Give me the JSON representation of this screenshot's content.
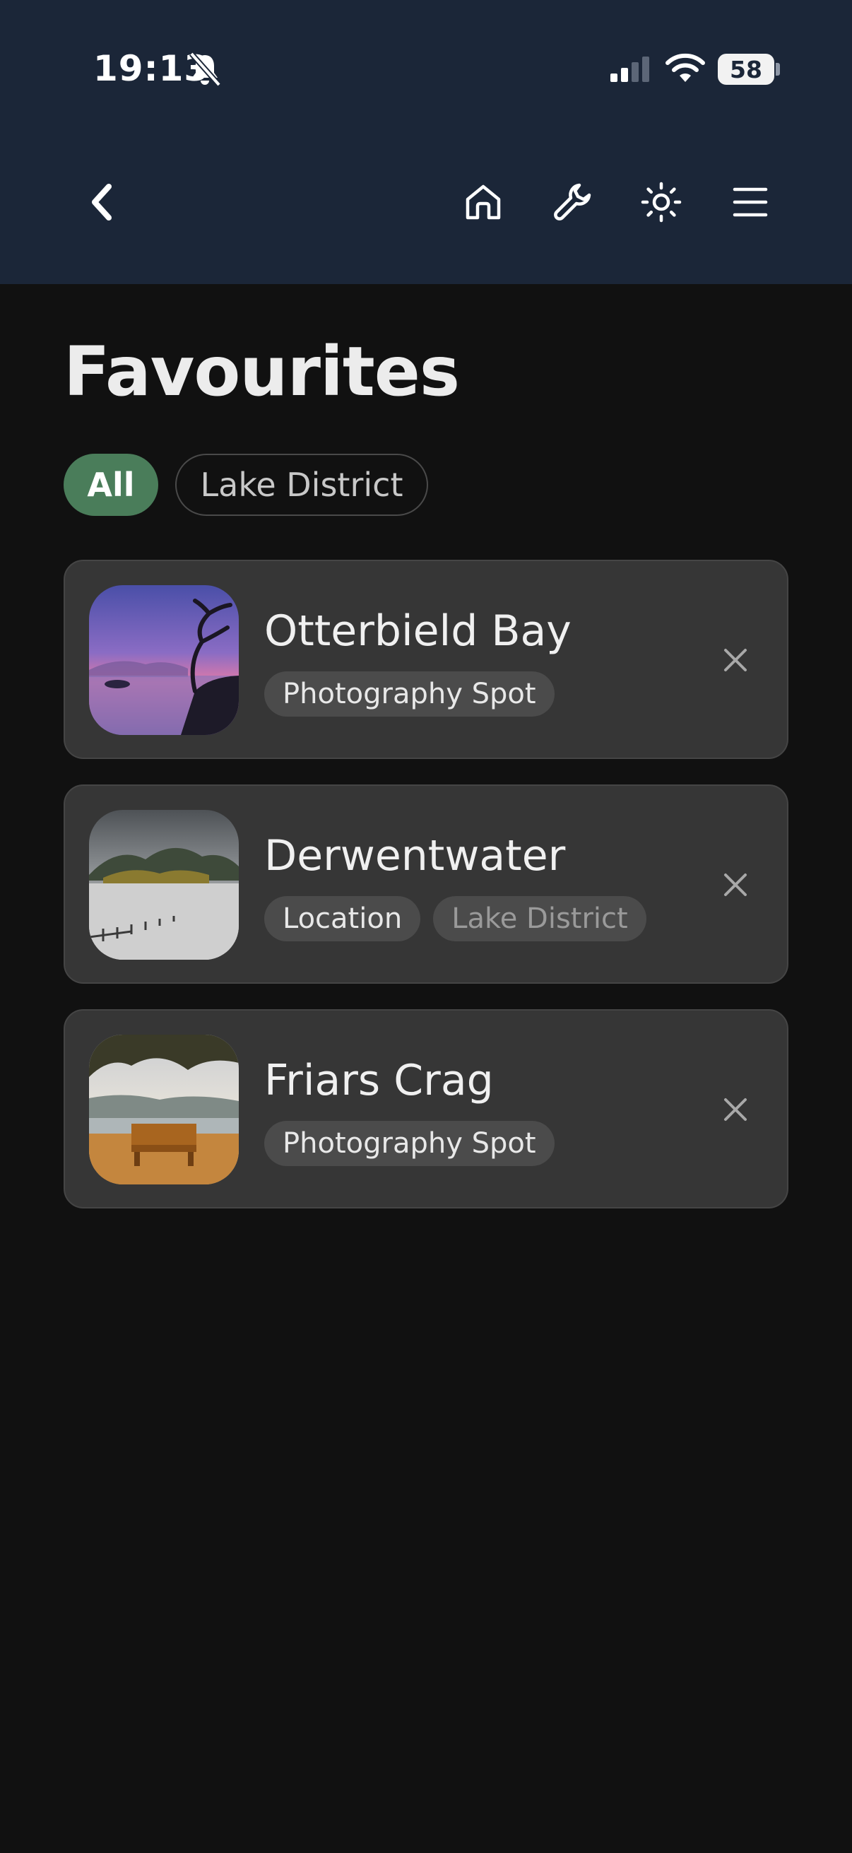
{
  "status_bar": {
    "time": "19:13",
    "battery": "58",
    "icons": [
      "bell-slash-icon",
      "cellular-signal-icon",
      "wifi-icon",
      "battery-icon"
    ]
  },
  "nav": {
    "icons": [
      "chevron-left-icon",
      "home-icon",
      "wrench-icon",
      "sun-icon",
      "hamburger-menu-icon"
    ]
  },
  "page": {
    "title": "Favourites"
  },
  "filters": [
    {
      "label": "All",
      "selected": true
    },
    {
      "label": "Lake District",
      "selected": false
    }
  ],
  "favourites": [
    {
      "title": "Otterbield Bay",
      "tags": [
        {
          "label": "Photography Spot"
        }
      ],
      "remove_icon": "close-icon"
    },
    {
      "title": "Derwentwater",
      "tags": [
        {
          "label": "Location"
        },
        {
          "label": "Lake District"
        }
      ],
      "remove_icon": "close-icon"
    },
    {
      "title": "Friars Crag",
      "tags": [
        {
          "label": "Photography Spot"
        }
      ],
      "remove_icon": "close-icon"
    }
  ],
  "colors": {
    "header_bg": "#1b2638",
    "page_bg": "#111111",
    "card_bg": "#363636",
    "accent_green": "#4a7d5a"
  }
}
